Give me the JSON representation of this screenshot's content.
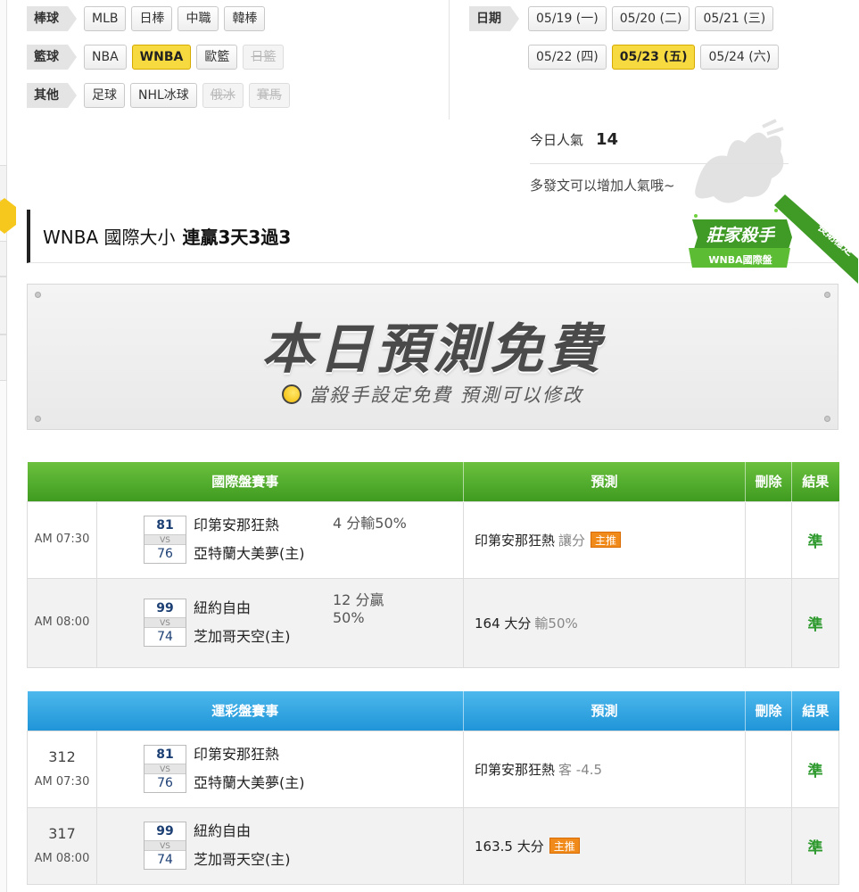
{
  "categories": [
    {
      "label": "棒球",
      "items": [
        {
          "label": "MLB",
          "state": "normal"
        },
        {
          "label": "日棒",
          "state": "normal"
        },
        {
          "label": "中職",
          "state": "normal"
        },
        {
          "label": "韓棒",
          "state": "normal"
        }
      ]
    },
    {
      "label": "籃球",
      "items": [
        {
          "label": "NBA",
          "state": "normal"
        },
        {
          "label": "WNBA",
          "state": "active"
        },
        {
          "label": "歐籃",
          "state": "normal"
        },
        {
          "label": "日籃",
          "state": "disabled"
        }
      ]
    },
    {
      "label": "其他",
      "items": [
        {
          "label": "足球",
          "state": "normal"
        },
        {
          "label": "NHL冰球",
          "state": "normal"
        },
        {
          "label": "俄冰",
          "state": "disabled"
        },
        {
          "label": "賽馬",
          "state": "disabled"
        }
      ]
    }
  ],
  "dates": {
    "label": "日期",
    "row1": [
      {
        "label": "05/19 (一)",
        "state": "normal"
      },
      {
        "label": "05/20 (二)",
        "state": "normal"
      },
      {
        "label": "05/21 (三)",
        "state": "normal"
      }
    ],
    "row2": [
      {
        "label": "05/22 (四)",
        "state": "normal"
      },
      {
        "label": "05/23 (五)",
        "state": "active"
      },
      {
        "label": "05/24 (六)",
        "state": "normal"
      }
    ]
  },
  "popularity": {
    "label": "今日人氣",
    "value": "14",
    "hint": "多發文可以增加人氣哦~"
  },
  "title": {
    "league": "WNBA 國際大小",
    "streak": "連贏3天3過3"
  },
  "badge": {
    "main": "莊家殺手",
    "sub": "WNBA國際盤",
    "ribbon": "長期穩定"
  },
  "banner": {
    "title": "本日預測免費",
    "subtitle": "當殺手設定免費 預測可以修改"
  },
  "international_table": {
    "headers": {
      "event": "國際盤賽事",
      "prediction": "預測",
      "delete": "刪除",
      "result": "結果"
    },
    "rows": [
      {
        "time": "AM 07:30",
        "away_score": "81",
        "home_score": "76",
        "vs": "VS",
        "away_team": "印第安那狂熱",
        "home_team": "亞特蘭大美夢(主)",
        "handicap_line1": "4 分輸50%",
        "handicap_line2": "",
        "pred_main": "印第安那狂熱",
        "pred_extra": "讓分",
        "pred_tag": "主推",
        "result": "準"
      },
      {
        "time": "AM 08:00",
        "away_score": "99",
        "home_score": "74",
        "vs": "VS",
        "away_team": "紐約自由",
        "home_team": "芝加哥天空(主)",
        "handicap_line1": "12 分贏",
        "handicap_line2": "50%",
        "pred_main": "164 大分",
        "pred_extra": "輸50%",
        "pred_tag": "",
        "result": "準"
      }
    ]
  },
  "lottery_table": {
    "headers": {
      "event": "運彩盤賽事",
      "prediction": "預測",
      "delete": "刪除",
      "result": "結果"
    },
    "rows": [
      {
        "game_id": "312",
        "time": "AM 07:30",
        "away_score": "81",
        "home_score": "76",
        "vs": "VS",
        "away_team": "印第安那狂熱",
        "home_team": "亞特蘭大美夢(主)",
        "pred_main": "印第安那狂熱",
        "pred_extra": "客 -4.5",
        "pred_tag": "",
        "result": "準"
      },
      {
        "game_id": "317",
        "time": "AM 08:00",
        "away_score": "99",
        "home_score": "74",
        "vs": "VS",
        "away_team": "紐約自由",
        "home_team": "芝加哥天空(主)",
        "pred_main": "163.5 大分",
        "pred_extra": "",
        "pred_tag": "主推",
        "result": "準"
      }
    ]
  }
}
